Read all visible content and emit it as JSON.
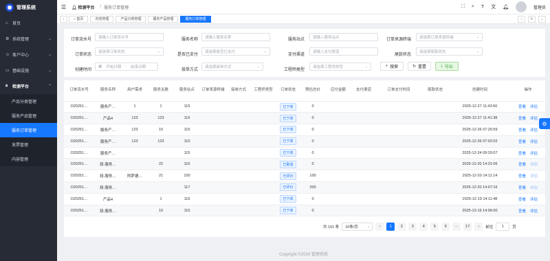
{
  "app": {
    "title": "管理系统"
  },
  "sidebar": {
    "items": [
      {
        "label": "首页",
        "icon": "home-icon"
      },
      {
        "label": "系统管理",
        "icon": "gear-icon"
      },
      {
        "label": "客户中心",
        "icon": "user-icon"
      },
      {
        "label": "基础设施",
        "icon": "monitor-icon"
      },
      {
        "label": "检测平台",
        "icon": "lock-icon"
      }
    ],
    "sub_items": [
      {
        "label": "产品分类管理"
      },
      {
        "label": "服务产品管理"
      },
      {
        "label": "服务订单管理",
        "active": true
      },
      {
        "label": "发票管理"
      },
      {
        "label": "内容管理"
      }
    ]
  },
  "header": {
    "platform": "检测平台",
    "current": "服务订单管理",
    "user_name": "管理员"
  },
  "tabs": [
    "首页",
    "内容管理",
    "产品分类管理",
    "服务产品管理",
    "服务订单管理"
  ],
  "filters": {
    "order_no": {
      "label": "订单流水号",
      "placeholder": "请输入订单流水号"
    },
    "service_name": {
      "label": "服务名称",
      "placeholder": "请输入服务名称"
    },
    "service_site": {
      "label": "服务站点",
      "placeholder": "请输入服务站点"
    },
    "source_terminal": {
      "label": "订单来源终端",
      "placeholder": "请选择订单来源终端"
    },
    "order_status": {
      "label": "订单状态",
      "placeholder": "请选择订单状态"
    },
    "paid": {
      "label": "是否已支付",
      "placeholder": "请选择是否已支付"
    },
    "pay_channel": {
      "label": "支付渠道",
      "placeholder": "请输入支付渠道"
    },
    "final_status": {
      "label": "尾款状态",
      "placeholder": "请选择尾款状态"
    },
    "created": {
      "label": "创建时间",
      "start": "开始日期",
      "sep": "-",
      "end": "结束日期"
    },
    "take_mode": {
      "label": "接单方式",
      "placeholder": "请选择接单方式"
    },
    "eng_type": {
      "label": "工程师类型",
      "placeholder": "请选择工程师类型"
    },
    "search_label": "搜索",
    "reset_label": "重置",
    "export_label": "导出"
  },
  "table": {
    "headers": [
      "订单流水号",
      "服务名称",
      "用户需求",
      "服务关数",
      "服务站点",
      "订单来源终端",
      "接单方式",
      "工程师类型",
      "订单状态",
      "预估总价",
      "应付金额",
      "支付渠道",
      "订单支付时间",
      "尾款状态",
      "创建时间",
      "操作"
    ],
    "rows": [
      {
        "no": "O20251…",
        "name": "服务产…",
        "need": "1",
        "count": "1",
        "site": "115",
        "status": "已下单",
        "est": "0",
        "created": "2025-12-27 11:43:50",
        "eval_dim": false
      },
      {
        "no": "O20251…",
        "name": "产品4",
        "need": "123",
        "count": "123",
        "site": "115",
        "status": "已下单",
        "est": "0",
        "created": "2025-12-27 11:41:38",
        "eval_dim": false
      },
      {
        "no": "O20251…",
        "name": "服务产…",
        "need": "123",
        "count": "10",
        "site": "115",
        "status": "已下单",
        "est": "0",
        "created": "2025-12-26 07:26:59",
        "eval_dim": false
      },
      {
        "no": "O20251…",
        "name": "服务产…",
        "need": "123",
        "count": "123",
        "site": "115",
        "status": "已下单",
        "est": "0",
        "created": "2025-12-26 07:02:02",
        "eval_dim": false
      },
      {
        "no": "O20251…",
        "name": "服务产…",
        "need": "",
        "count": "",
        "site": "115",
        "status": "已下单",
        "est": "0",
        "created": "2025-12-24 09:20:07",
        "eval_dim": false
      },
      {
        "no": "O20251…",
        "name": "段-服务…",
        "need": "",
        "count": "22",
        "site": "115",
        "status": "已取消",
        "est": "0",
        "created": "2025-12-20 14:31:06",
        "eval_dim": true
      },
      {
        "no": "O20251…",
        "name": "段-服务…",
        "need": "阿萨德…",
        "count": "21",
        "site": "100",
        "status": "已评价",
        "est": "100",
        "created": "2025-12-20 14:11:14",
        "eval_dim": true
      },
      {
        "no": "O20251…",
        "name": "段-服务…",
        "need": "",
        "count": "",
        "site": "117",
        "status": "已评价",
        "est": "200",
        "created": "2025-12-20 14:07:16",
        "eval_dim": true
      },
      {
        "no": "O20251…",
        "name": "产品4",
        "need": "",
        "count": "1",
        "site": "116",
        "status": "已下单",
        "est": "0",
        "created": "2025-12-19 14:11:48",
        "eval_dim": false
      },
      {
        "no": "O20251…",
        "name": "段-服务…",
        "need": "",
        "count": "10",
        "site": "115",
        "status": "已下单",
        "est": "0",
        "created": "2025-12-19 14:06:00",
        "eval_dim": false
      }
    ],
    "action_view": "查看",
    "action_eval": "评估"
  },
  "pagination": {
    "total": "共 161 条",
    "page_size": "10条/页",
    "pages": [
      "1",
      "2",
      "3",
      "4",
      "5",
      "6"
    ],
    "ellipsis": "···",
    "last": "17",
    "goto_label": "前往",
    "goto_value": "1",
    "page_suffix": "页"
  },
  "footer": "Copyright ©2026 管理系统",
  "colors": {
    "accent": "#1677ff",
    "sidebar": "#262b36",
    "export": "#4caf50"
  }
}
